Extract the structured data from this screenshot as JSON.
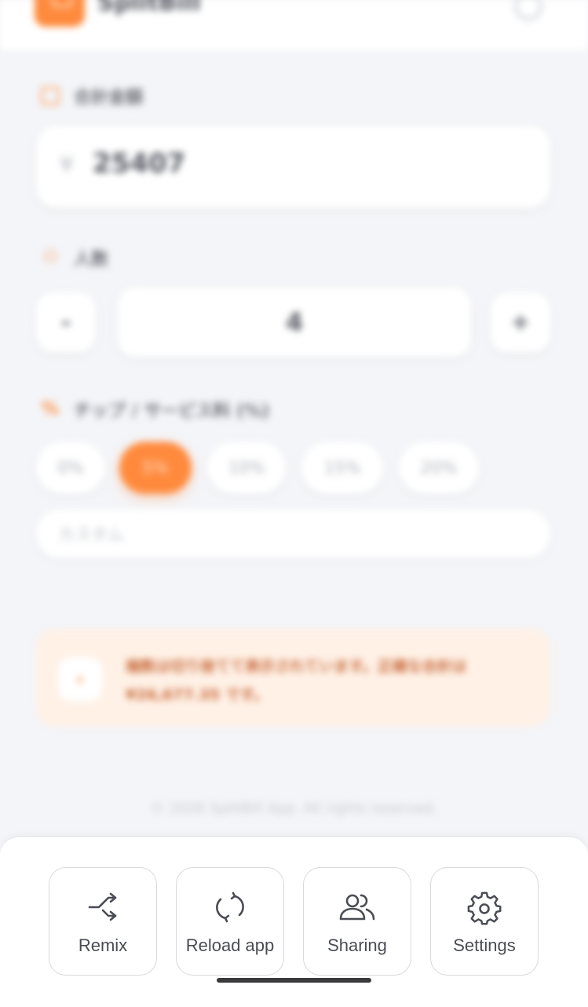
{
  "header": {
    "app_name": "SplitBill"
  },
  "amount": {
    "label": "合計金額",
    "currency": "¥",
    "value": "25407"
  },
  "people": {
    "label": "人数",
    "minus": "-",
    "value": "4",
    "plus": "+"
  },
  "tip": {
    "label": "チップ / サービス料 (%)",
    "options": [
      "0%",
      "5%",
      "10%",
      "15%",
      "20%"
    ],
    "selected": "5%",
    "custom_placeholder": "カスタム"
  },
  "notice": {
    "text": "端数は切り捨てて表示されています。正確な合計は ¥26,677.35 です。"
  },
  "footer": "© 2026 SplitBill App. All rights reserved.",
  "sheet": {
    "actions": [
      {
        "label": "Remix",
        "icon": "shuffle-icon"
      },
      {
        "label": "Reload app",
        "icon": "reload-icon"
      },
      {
        "label": "Sharing",
        "icon": "users-icon"
      },
      {
        "label": "Settings",
        "icon": "gear-icon"
      }
    ]
  },
  "colors": {
    "accent": "#ff8a3d",
    "background": "#f4f5f8",
    "notice_bg": "#fff1e6"
  }
}
